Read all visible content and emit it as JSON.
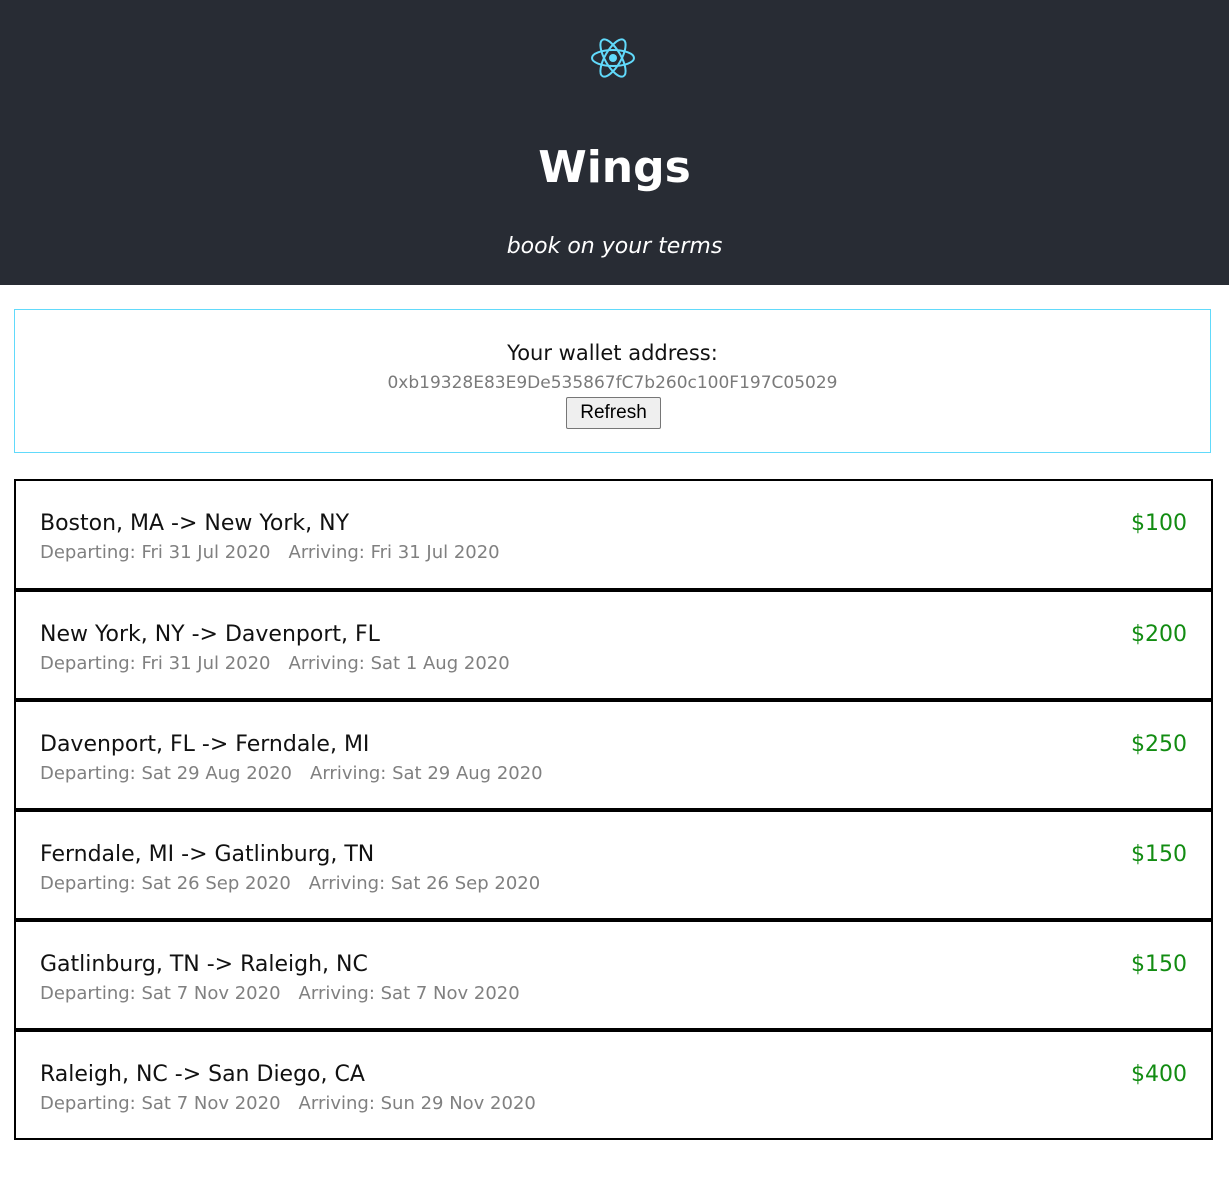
{
  "app": {
    "title": "Wings",
    "tagline": "book on your terms",
    "logo_icon": "react-atom-icon",
    "colors": {
      "header_bg": "#282c34",
      "accent": "#61dafb",
      "price": "#128c12"
    }
  },
  "wallet": {
    "label": "Your wallet address:",
    "address": "0xb19328E83E9De535867fC7b260c100F197C05029",
    "refresh_label": "Refresh"
  },
  "flights": [
    {
      "route": "Boston, MA -> New York, NY",
      "departing": "Departing: Fri 31 Jul 2020",
      "arriving": "Arriving: Fri 31 Jul 2020",
      "price": "$100"
    },
    {
      "route": "New York, NY -> Davenport, FL",
      "departing": "Departing: Fri 31 Jul 2020",
      "arriving": "Arriving: Sat 1 Aug 2020",
      "price": "$200"
    },
    {
      "route": "Davenport, FL -> Ferndale, MI",
      "departing": "Departing: Sat 29 Aug 2020",
      "arriving": "Arriving: Sat 29 Aug 2020",
      "price": "$250"
    },
    {
      "route": "Ferndale, MI -> Gatlinburg, TN",
      "departing": "Departing: Sat 26 Sep 2020",
      "arriving": "Arriving: Sat 26 Sep 2020",
      "price": "$150"
    },
    {
      "route": "Gatlinburg, TN -> Raleigh, NC",
      "departing": "Departing: Sat 7 Nov 2020",
      "arriving": "Arriving: Sat 7 Nov 2020",
      "price": "$150"
    },
    {
      "route": "Raleigh, NC -> San Diego, CA",
      "departing": "Departing: Sat 7 Nov 2020",
      "arriving": "Arriving: Sun 29 Nov 2020",
      "price": "$400"
    }
  ]
}
